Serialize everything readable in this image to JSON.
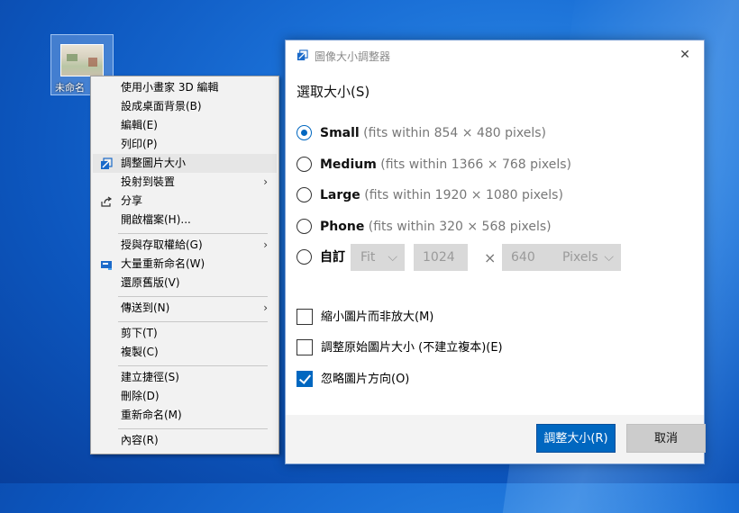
{
  "desktop": {
    "icon_label": "未命名"
  },
  "context_menu": {
    "items": [
      {
        "label": "使用小畫家 3D 編輯"
      },
      {
        "label": "設成桌面背景(B)"
      },
      {
        "label": "編輯(E)"
      },
      {
        "label": "列印(P)"
      },
      {
        "label": "調整圖片大小"
      },
      {
        "label": "投射到裝置"
      },
      {
        "label": "分享"
      },
      {
        "label": "開啟檔案(H)..."
      },
      {
        "label": "授與存取權給(G)"
      },
      {
        "label": "大量重新命名(W)"
      },
      {
        "label": "還原舊版(V)"
      },
      {
        "label": "傳送到(N)"
      },
      {
        "label": "剪下(T)"
      },
      {
        "label": "複製(C)"
      },
      {
        "label": "建立捷徑(S)"
      },
      {
        "label": "刪除(D)"
      },
      {
        "label": "重新命名(M)"
      },
      {
        "label": "內容(R)"
      }
    ]
  },
  "dialog": {
    "title": "圖像大小調整器",
    "heading": "選取大小(S)",
    "options": [
      {
        "name": "Small",
        "hint": "(fits within 854 × 480 pixels)",
        "selected": true
      },
      {
        "name": "Medium",
        "hint": "(fits within 1366 × 768 pixels)",
        "selected": false
      },
      {
        "name": "Large",
        "hint": "(fits within 1920 × 1080 pixels)",
        "selected": false
      },
      {
        "name": "Phone",
        "hint": "(fits within 320 × 568 pixels)",
        "selected": false
      }
    ],
    "custom": {
      "label": "自訂",
      "mode": "Fit",
      "width": "1024",
      "times": "×",
      "height": "640",
      "unit": "Pixels"
    },
    "checkboxes": [
      {
        "label": "縮小圖片而非放大(M)",
        "checked": false
      },
      {
        "label": "調整原始圖片大小 (不建立複本)(E)",
        "checked": false
      },
      {
        "label": "忽略圖片方向(O)",
        "checked": true
      }
    ],
    "resize_button": "調整大小(R)",
    "cancel_button": "取消"
  },
  "colors": {
    "accent": "#0067c0",
    "desktop": "#1a6fd6"
  }
}
